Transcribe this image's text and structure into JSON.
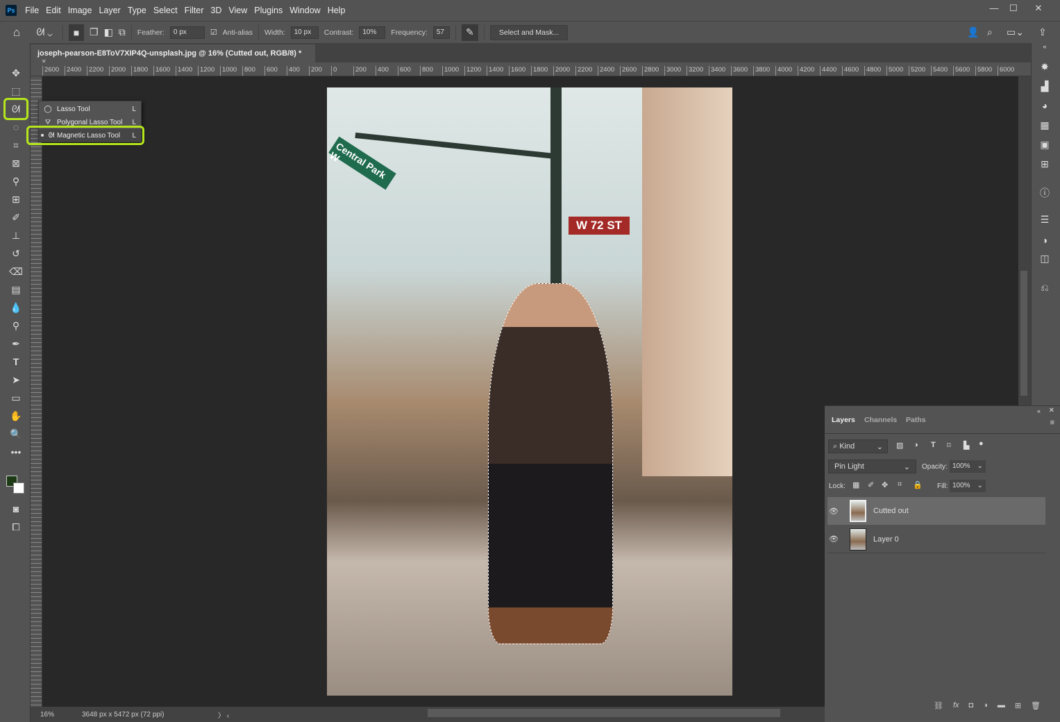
{
  "app": {
    "logo": "Ps"
  },
  "menu": [
    "File",
    "Edit",
    "Image",
    "Layer",
    "Type",
    "Select",
    "Filter",
    "3D",
    "View",
    "Plugins",
    "Window",
    "Help"
  ],
  "window_controls": {
    "minimize": "—",
    "maximize": "☐",
    "close": "✕"
  },
  "options": {
    "feather_label": "Feather:",
    "feather_value": "0 px",
    "antialias_label": "Anti-alias",
    "antialias_checked": true,
    "width_label": "Width:",
    "width_value": "10 px",
    "contrast_label": "Contrast:",
    "contrast_value": "10%",
    "frequency_label": "Frequency:",
    "frequency_value": "57",
    "select_mask_label": "Select and Mask..."
  },
  "document": {
    "tab_title": "joseph-pearson-E8ToV7XIP4Q-unsplash.jpg @ 16% (Cutted out, RGB/8) *",
    "close": "×"
  },
  "ruler": {
    "h_ticks": [
      "2600",
      "2400",
      "2200",
      "2000",
      "1800",
      "1600",
      "1400",
      "1200",
      "1000",
      "800",
      "600",
      "400",
      "200",
      "0",
      "200",
      "400",
      "600",
      "800",
      "1000",
      "1200",
      "1400",
      "1600",
      "1800",
      "2000",
      "2200",
      "2400",
      "2600",
      "2800",
      "3000",
      "3200",
      "3400",
      "3600",
      "3800",
      "4000",
      "4200",
      "4400",
      "4600",
      "4800",
      "5000",
      "5200",
      "5400",
      "5600",
      "5800",
      "6000"
    ]
  },
  "photo": {
    "sign1": "Central Park W",
    "sign2": "W 72 ST"
  },
  "flyout": {
    "items": [
      {
        "label": "Lasso Tool",
        "key": "L",
        "selected": false
      },
      {
        "label": "Polygonal Lasso Tool",
        "key": "L",
        "selected": false
      },
      {
        "label": "Magnetic Lasso Tool",
        "key": "L",
        "selected": true
      }
    ]
  },
  "highlight_color": "#b5e61d",
  "status": {
    "zoom": "16%",
    "doc_size": "3648 px x 5472 px (72 ppi)"
  },
  "layers_panel": {
    "tabs": [
      "Layers",
      "Channels",
      "Paths"
    ],
    "active_tab": "Layers",
    "filter_kind": "Kind",
    "blend_mode": "Pin Light",
    "opacity_label": "Opacity:",
    "opacity": "100%",
    "lock_label": "Lock:",
    "fill_label": "Fill:",
    "fill": "100%",
    "layers": [
      {
        "name": "Cutted out",
        "visible": true,
        "selected": true
      },
      {
        "name": "Layer 0",
        "visible": true,
        "selected": false
      }
    ]
  }
}
